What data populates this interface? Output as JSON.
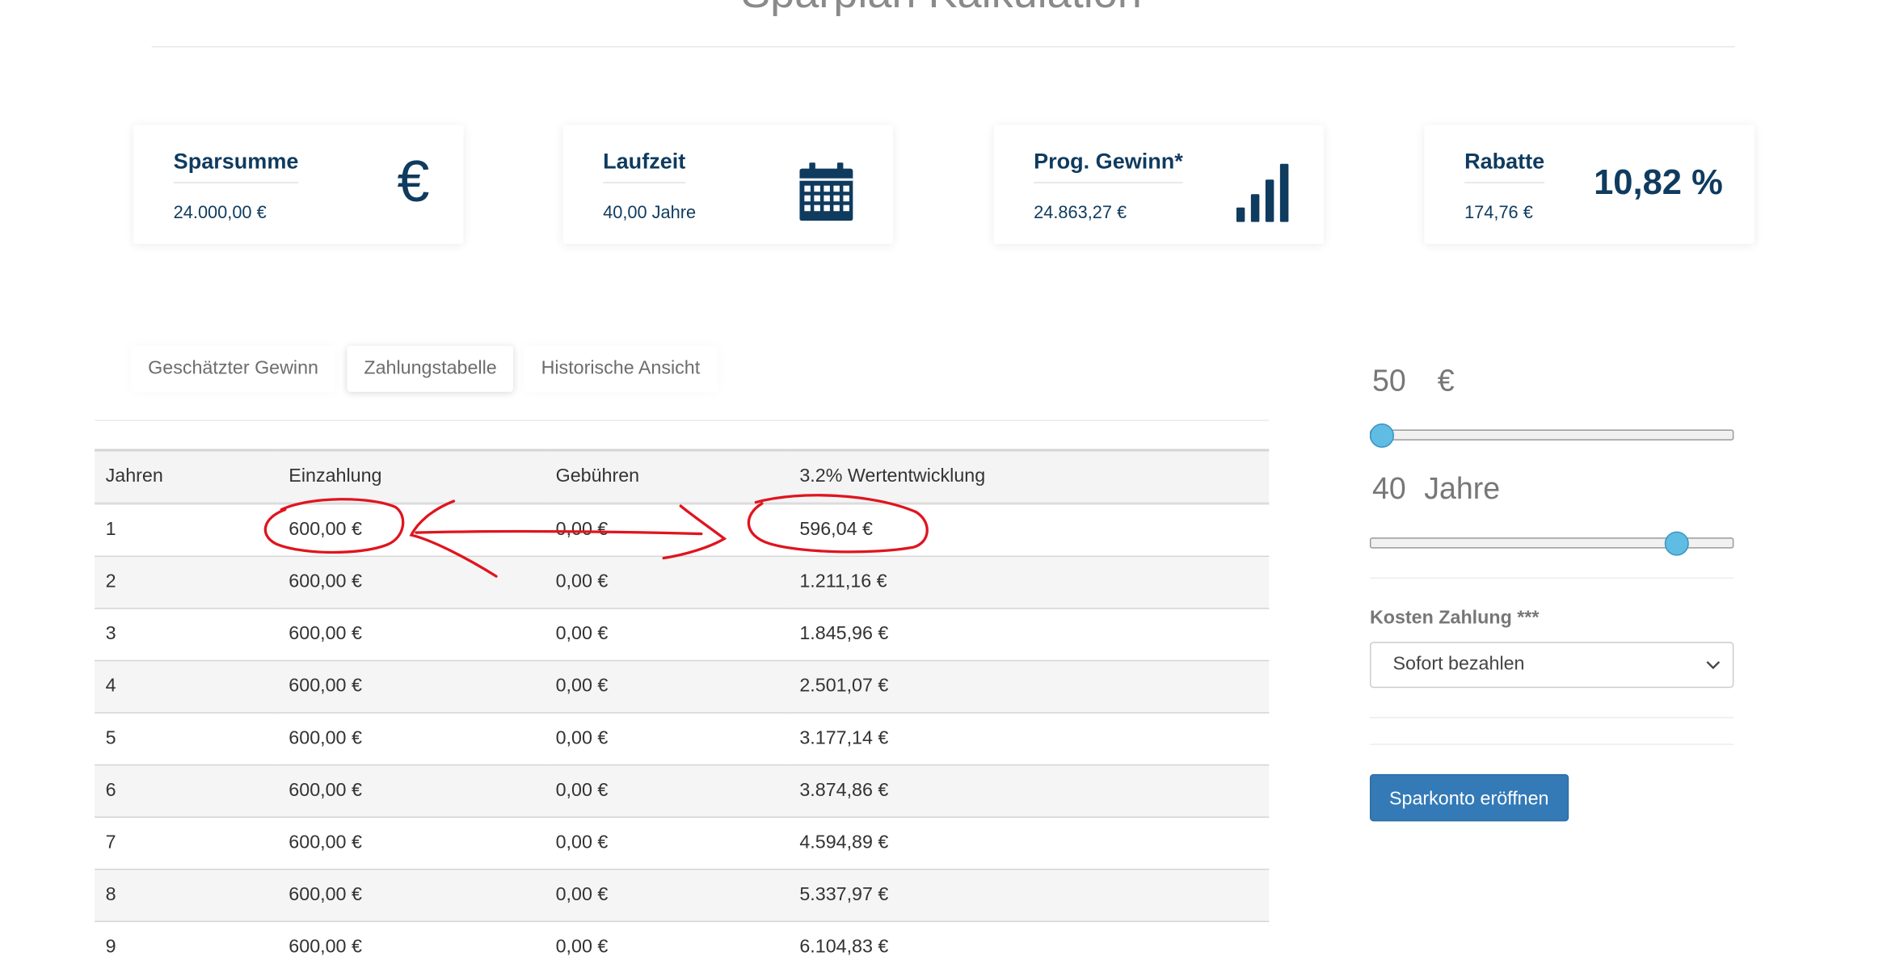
{
  "page": {
    "title": "Sparplan Kalkulation"
  },
  "cards": [
    {
      "title": "Sparsumme",
      "value": "24.000,00 €",
      "icon": "euro-icon",
      "icon_text": "€"
    },
    {
      "title": "Laufzeit",
      "value": "40,00 Jahre",
      "icon": "calendar-icon"
    },
    {
      "title": "Prog. Gewinn*",
      "value": "24.863,27 €",
      "icon": "signal-bars-icon"
    },
    {
      "title": "Rabatte",
      "value": "174,76 €",
      "highlight": "10,82 %"
    }
  ],
  "tabs": [
    {
      "label": "Geschätzter Gewinn",
      "active": false
    },
    {
      "label": "Zahlungstabelle",
      "active": true
    },
    {
      "label": "Historische Ansicht",
      "active": false
    }
  ],
  "table": {
    "headers": [
      "Jahren",
      "Einzahlung",
      "Gebühren",
      "3.2% Wertentwicklung"
    ],
    "rows": [
      [
        "1",
        "600,00 €",
        "0,00 €",
        "596,04 €"
      ],
      [
        "2",
        "600,00 €",
        "0,00 €",
        "1.211,16 €"
      ],
      [
        "3",
        "600,00 €",
        "0,00 €",
        "1.845,96 €"
      ],
      [
        "4",
        "600,00 €",
        "0,00 €",
        "2.501,07 €"
      ],
      [
        "5",
        "600,00 €",
        "0,00 €",
        "3.177,14 €"
      ],
      [
        "6",
        "600,00 €",
        "0,00 €",
        "3.874,86 €"
      ],
      [
        "7",
        "600,00 €",
        "0,00 €",
        "4.594,89 €"
      ],
      [
        "8",
        "600,00 €",
        "0,00 €",
        "5.337,97 €"
      ],
      [
        "9",
        "600,00 €",
        "0,00 €",
        "6.104,83 €"
      ]
    ]
  },
  "sidebar": {
    "amount": {
      "value": "50",
      "unit": "€",
      "level": 0.03
    },
    "duration": {
      "value": "40",
      "unit": "Jahre",
      "level": 0.84
    },
    "cost_label": "Kosten Zahlung ***",
    "cost_selected": "Sofort bezahlen",
    "open_button": "Sparkonto eröffnen"
  },
  "colors": {
    "brand_dark": "#0f3b5f",
    "button_blue": "#337ab7",
    "slider_handle": "#5fbde4",
    "annotation_red": "#e0141e"
  }
}
